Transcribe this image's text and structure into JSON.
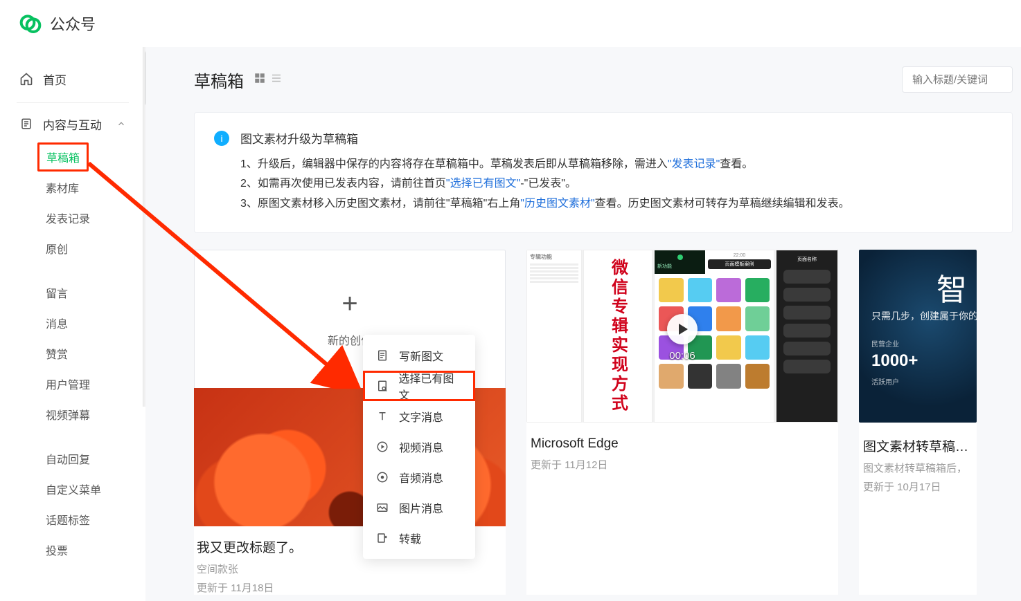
{
  "app": {
    "name": "公众号"
  },
  "sidebar": {
    "home": "首页",
    "section_content": "内容与互动",
    "items": {
      "drafts": "草稿箱",
      "materials": "素材库",
      "publish_log": "发表记录",
      "original": "原创",
      "comments": "留言",
      "messages": "消息",
      "rewards": "赞赏",
      "user_mgmt": "用户管理",
      "video_danmu": "视频弹幕",
      "auto_reply": "自动回复",
      "custom_menu": "自定义菜单",
      "topic_tags": "话题标签",
      "vote": "投票"
    }
  },
  "page": {
    "title": "草稿箱",
    "search_placeholder": "输入标题/关键词"
  },
  "notice": {
    "title": "图文素材升级为草稿箱",
    "l1_pre": "1、升级后，编辑器中保存的内容将存在草稿箱中。草稿发表后即从草稿箱移除，需进入",
    "l1_link": "\"发表记录\"",
    "l1_post": "查看。",
    "l2_pre": "2、如需再次使用已发表内容，请前往首页",
    "l2_link": "\"选择已有图文\"",
    "l2_post": "-\"已发表\"。",
    "l3_pre": "3、原图文素材移入历史图文素材，请前往\"草稿箱\"右上角",
    "l3_link": "\"历史图文素材\"",
    "l3_post": "查看。历史图文素材可转存为草稿继续编辑和发表。"
  },
  "create": {
    "plus": "+",
    "label": "新的创作"
  },
  "menu": {
    "new_article": "写新图文",
    "pick_existing": "选择已有图文",
    "text_msg": "文字消息",
    "video_msg": "视频消息",
    "audio_msg": "音频消息",
    "image_msg": "图片消息",
    "repost": "转载"
  },
  "card1": {
    "title": "我又更改标题了。",
    "subtitle": "空间款张",
    "time": "更新于 11月18日"
  },
  "card2": {
    "duration": "00:06",
    "title": "Microsoft Edge",
    "time": "更新于 11月12日",
    "mock_red_text": "微信专辑实现方式",
    "mock_top1": "专辑功能",
    "mock_top2": "新功能",
    "mock_top3": "页面模板案例",
    "mock_top4": "页面名称",
    "mock_time": "22:00"
  },
  "card3": {
    "big": "智",
    "line": "只需几步，创建属于你的公",
    "mini": "民营企业",
    "k": "1000+",
    "tiny": "活跃用户",
    "title": "图文素材转草稿箱后",
    "subtitle": "图文素材转草稿箱后，",
    "time": "更新于 10月17日"
  }
}
